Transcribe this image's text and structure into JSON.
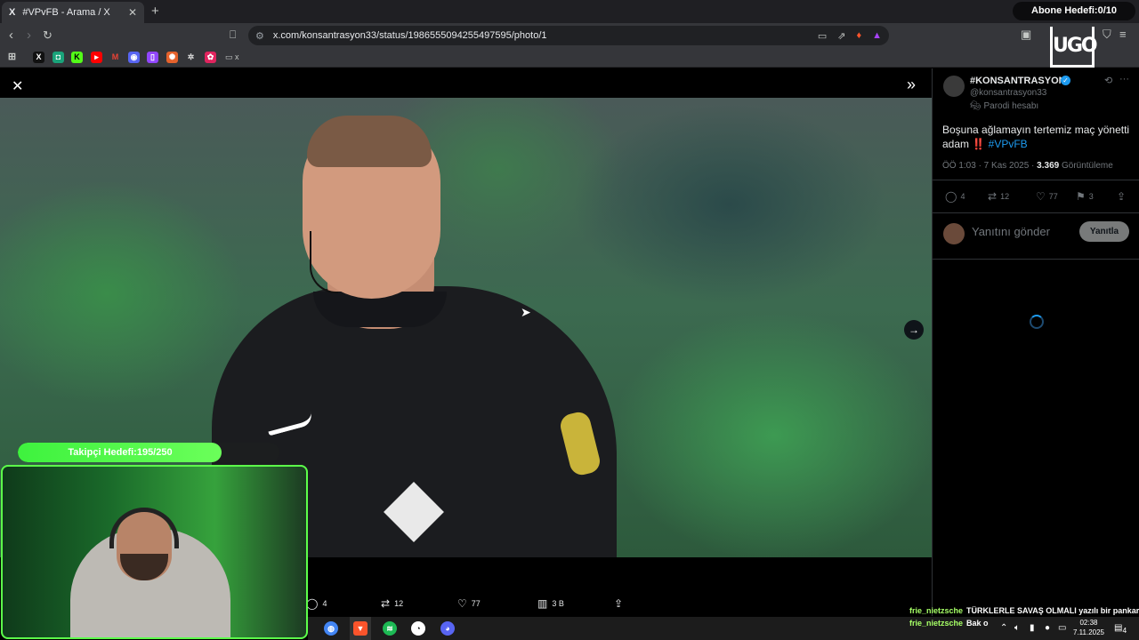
{
  "browser": {
    "tab_title": "#VPvFB - Arama / X",
    "tab_favicon": "X",
    "url": "x.com/konsantrasyon33/status/1986555094255497595/photo/1",
    "bookmark_folder": "x"
  },
  "overlays": {
    "subscriber_goal": "Abone Hedefi:0/10",
    "follower_goal": "Takipçi Hedefi:195/250",
    "follower_progress": 0.78
  },
  "viewer": {
    "stats": {
      "replies": "4",
      "reposts": "12",
      "likes": "77",
      "views": "3 B"
    }
  },
  "tweet": {
    "display_name": "#KONSANTRASYON",
    "handle": "@konsantrasyon33",
    "parody_label": "Parodi hesabı",
    "text_before": "Boşuna ağlamayın tertemiz maç yönetti adam ",
    "text_emoji": "‼️",
    "hashtag": "#VPvFB",
    "time": "ÖÖ 1:03 · 7 Kas 2025 · ",
    "views_count": "3.369",
    "views_label": " Görüntüleme",
    "replies": "4",
    "reposts": "12",
    "likes": "77",
    "bookmarks": "3",
    "reply_placeholder": "Yanıtını gönder",
    "reply_button": "Yanıtla"
  },
  "chat": [
    {
      "user": "frie_nietzsche",
      "message": "TÜRKLERLE SAVAŞ OLMALI yazılı bir pankart"
    },
    {
      "user": "frie_nietzsche",
      "message": "Bak o"
    }
  ],
  "taskbar": {
    "time": "02:38",
    "date": "7.11.2025",
    "notifications": "4"
  },
  "colors": {
    "accent": "#1d9bf0",
    "goal_green": "#3ef23e"
  }
}
